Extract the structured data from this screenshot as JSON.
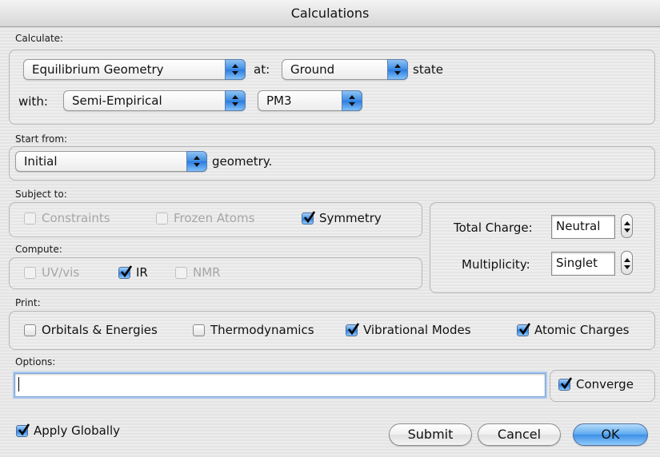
{
  "window": {
    "title": "Calculations"
  },
  "calculate": {
    "label": "Calculate:",
    "task": "Equilibrium Geometry",
    "at_label": "at:",
    "state": "Ground",
    "state_suffix": "state",
    "with_label": "with:",
    "method": "Semi-Empirical",
    "basis": "PM3"
  },
  "start_from": {
    "label": "Start from:",
    "value": "Initial",
    "suffix": "geometry."
  },
  "subject_to": {
    "label": "Subject to:",
    "constraints": {
      "label": "Constraints",
      "checked": false,
      "enabled": false
    },
    "frozen_atoms": {
      "label": "Frozen Atoms",
      "checked": false,
      "enabled": false
    },
    "symmetry": {
      "label": "Symmetry",
      "checked": true,
      "enabled": true
    }
  },
  "compute": {
    "label": "Compute:",
    "uvvis": {
      "label": "UV/vis",
      "checked": false,
      "enabled": false
    },
    "ir": {
      "label": "IR",
      "checked": true,
      "enabled": true
    },
    "nmr": {
      "label": "NMR",
      "checked": false,
      "enabled": false
    }
  },
  "charge": {
    "total_charge_label": "Total Charge:",
    "total_charge_value": "Neutral",
    "multiplicity_label": "Multiplicity:",
    "multiplicity_value": "Singlet"
  },
  "print": {
    "label": "Print:",
    "orbitals": {
      "label": "Orbitals & Energies",
      "checked": false
    },
    "thermo": {
      "label": "Thermodynamics",
      "checked": false
    },
    "vibrational": {
      "label": "Vibrational Modes",
      "checked": true
    },
    "atomic_charges": {
      "label": "Atomic Charges",
      "checked": true
    }
  },
  "options": {
    "label": "Options:",
    "value": "",
    "converge": {
      "label": "Converge",
      "checked": true
    }
  },
  "footer": {
    "apply_globally": {
      "label": "Apply Globally",
      "checked": true
    },
    "submit": "Submit",
    "cancel": "Cancel",
    "ok": "OK"
  },
  "colors": {
    "accent": "#3d8fe6",
    "disabled_text": "#a6a6a6"
  }
}
